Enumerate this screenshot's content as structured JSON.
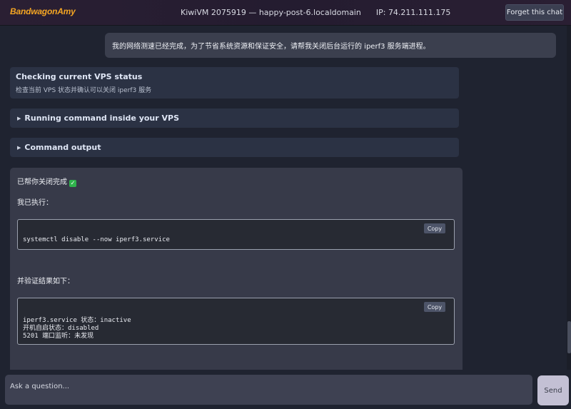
{
  "header": {
    "logo": "BandwagonAmy",
    "vm_name": "KiwiVM 2075919",
    "dash": "—",
    "hostname": "happy-post-6.localdomain",
    "ip_label": "IP:",
    "ip": "74.211.111.175",
    "forget_label": "Forget this chat"
  },
  "chat": {
    "user_message": "我的网络测速已经完成，为了节省系统资源和保证安全，请帮我关闭后台运行的 iperf3 服务端进程。",
    "status_card": {
      "title": "Checking current VPS status",
      "subtitle": "检查当前 VPS 状态并确认可以关闭 iperf3 服务"
    },
    "running_label": "Running command inside your VPS",
    "output_label": "Command output",
    "reply": {
      "done_text": "已帮你关闭完成",
      "executed_text": "我已执行：",
      "command": "systemctl disable --now iperf3.service",
      "verify_text": "并验证结果如下：",
      "result_lines": [
        "iperf3.service 状态：inactive",
        "开机自启状态：disabled",
        "5201 端口监听：未发现"
      ],
      "copy_label": "Copy"
    }
  },
  "composer": {
    "placeholder": "Ask a question...",
    "send_label": "Send"
  },
  "colors": {
    "accent_logo": "#f5a623",
    "background": "#1f2330",
    "card": "#2b3244",
    "check": "#2fb24c"
  },
  "icons": {
    "collapse": "triangle-right-icon",
    "done": "check-mark-icon"
  }
}
